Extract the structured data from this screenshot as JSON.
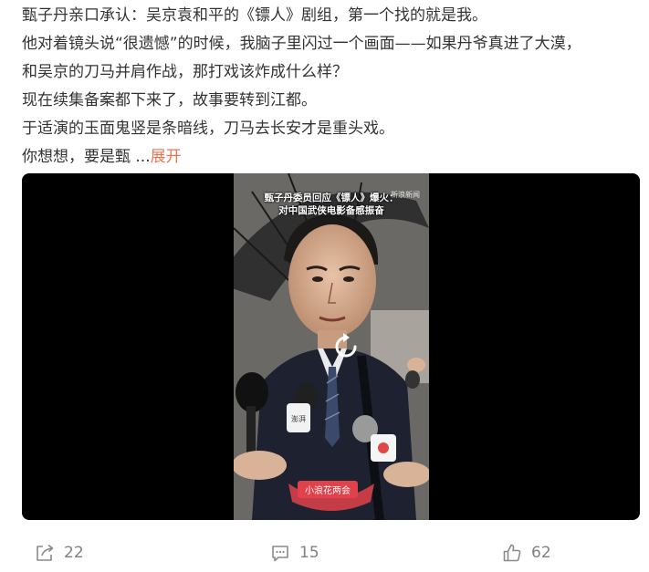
{
  "post": {
    "lines": [
      "甄子丹亲口承认：吴京袁和平的《镖人》剧组，第一个找的就是我。",
      "他对着镜头说“很遗憾”的时候，我脑子里闪过一个画面——如果丹爷真进了大漠，",
      "和吴京的刀马并肩作战，那打戏该炸成什么样？",
      "现在续集备案都下来了，故事要转到江都。",
      "于适演的玉面鬼竖是条暗线，刀马去长安才是重头戏。"
    ],
    "last_line": "你想想，要是甄",
    "ellipsis": " ...",
    "expand_label": "展开",
    "accent_color": "#eb7350"
  },
  "video": {
    "caption_line1": "甄子丹委员回应《镖人》爆火：",
    "caption_line2": "对中国武侠电影备感振奋",
    "watermark": "新浪新闻",
    "mic_label": "澎湃",
    "bottom_tag": "小浪花两会",
    "play_icon": "replay-icon"
  },
  "actions": {
    "share_icon": "share-icon",
    "share_count": "22",
    "comment_icon": "comment-icon",
    "comment_count": "15",
    "like_icon": "thumbs-up-icon",
    "like_count": "62"
  }
}
